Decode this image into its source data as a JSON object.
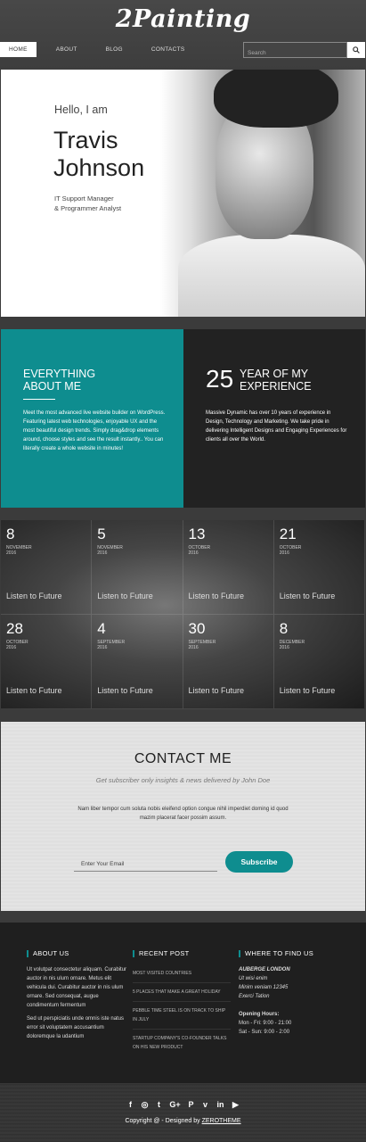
{
  "header": {
    "logo": "2Painting",
    "nav": [
      "HOME",
      "ABOUT",
      "BLOG",
      "CONTACTS"
    ],
    "search_placeholder": "Search",
    "search_icon": "search-icon"
  },
  "hero": {
    "greeting": "Hello, I am",
    "name": "Travis\nJohnson",
    "role": "IT Support Manager\n& Programmer Analyst"
  },
  "about": {
    "title": "EVERYTHING\nABOUT ME",
    "text": "Meet the most advanced live website builder on WordPress. Featuring latest web technologies, enjoyable UX and the most beautiful design trends. Simply drag&drop elements around, choose styles and see the result instantly.. You can literally create a whole website in minutes!",
    "experience_number": "25",
    "experience_title": "YEAR OF MY\nEXPERIENCE",
    "experience_text": "Massive Dynamic has over 10 years of experience in Design, Technology and Marketing. We take pride in delivering Intelligent Designs and Engaging Experiences for clients all over the World."
  },
  "events": [
    {
      "day": "8",
      "month": "NOVEMBER",
      "year": "2016",
      "link": "Listen to Future"
    },
    {
      "day": "5",
      "month": "NOVEMBER",
      "year": "2016",
      "link": "Listen to Future"
    },
    {
      "day": "13",
      "month": "OCTOBER",
      "year": "2016",
      "link": "Listen to Future"
    },
    {
      "day": "21",
      "month": "OCTOBER",
      "year": "2016",
      "link": "Listen to Future"
    },
    {
      "day": "28",
      "month": "OCTOBER",
      "year": "2016",
      "link": "Listen to Future"
    },
    {
      "day": "4",
      "month": "SEPTEMBER",
      "year": "2016",
      "link": "Listen to Future"
    },
    {
      "day": "30",
      "month": "SEPTEMBER",
      "year": "2016",
      "link": "Listen to Future"
    },
    {
      "day": "8",
      "month": "DECEMBER",
      "year": "2016",
      "link": "Listen to Future"
    }
  ],
  "contact": {
    "title": "CONTACT ME",
    "subtitle": "Get subscriber only insights & news delivered by John Doe",
    "text": "Nam liber tempor cum soluta nobis eleifend option congue nihil imperdiet doming id quod mazim placerat facer possim assum.",
    "email_placeholder": "Enter Your Email",
    "subscribe_label": "Subscribe"
  },
  "footer": {
    "about_heading": "ABOUT US",
    "about_p1": "Ut volutpat consectetur aliquam. Curabitur auctor in nis ulum ornare. Metus elit vehicula dui. Curabitur auctor in nis ulum ornare. Sed consequat, augue condimentum fermentum",
    "about_p2": "Sed ut perspiciatis unde omnis iste natus error sit voluptatem accusantium doloremque la udantium",
    "recent_heading": "RECENT POST",
    "posts": [
      "MOST VISITED COUNTRIES",
      "5 PLACES THAT MAKE A GREAT HOLIDAY",
      "PEBBLE TIME STEEL IS ON TRACK TO SHIP IN JULY",
      "STARTUP COMPANY'S CO-FOUNDER TALKS ON HIS NEW PRODUCT"
    ],
    "where_heading": "WHERE TO FIND US",
    "place": "AUBERGE LONDON",
    "address": "Ut wisi enim\nMinim veniam 12345\nExerci Tation",
    "hours_heading": "Opening Hours:",
    "hours": "Mon - Fri: 9:00 - 21:00\nSat - Sun: 9:00 - 2:00"
  },
  "bottom": {
    "social": [
      "f",
      "◎",
      "t",
      "G+",
      "P",
      "v",
      "in",
      "▶"
    ],
    "social_names": [
      "facebook-icon",
      "instagram-icon",
      "twitter-icon",
      "google-plus-icon",
      "pinterest-icon",
      "vimeo-icon",
      "linkedin-icon",
      "youtube-icon"
    ],
    "copyright": "Copyright @ - Designed by",
    "brand": "ZEROTHEME"
  }
}
